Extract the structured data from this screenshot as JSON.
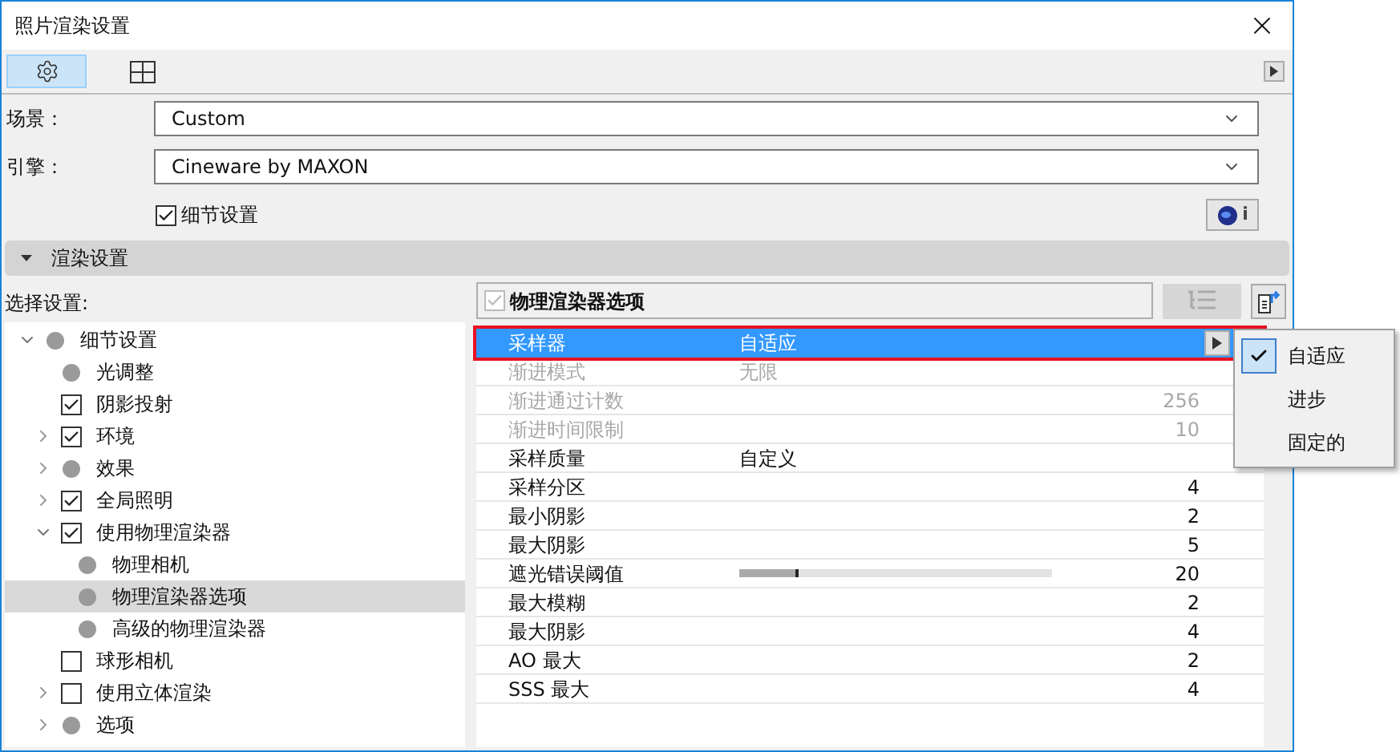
{
  "window": {
    "title": "照片渲染设置"
  },
  "toolbar": {
    "tabs": [
      {
        "selected": true
      },
      {
        "selected": false
      }
    ]
  },
  "fields": [
    {
      "label": "场景：",
      "value": "Custom"
    },
    {
      "label": "引擎：",
      "value": "Cineware by MAXON"
    }
  ],
  "detail_settings": {
    "label": "细节设置",
    "checked": true
  },
  "engine_info": {
    "label": "i"
  },
  "section": {
    "title": "渲染设置",
    "expanded": true
  },
  "select_label": "选择设置:",
  "panel_header": {
    "title": "物理渲染器选项",
    "checked": true
  },
  "tree": [
    {
      "label": "细节设置",
      "kind": "dot",
      "expanded": true,
      "selected": false,
      "children": [
        {
          "label": "光调整",
          "kind": "dot",
          "selected": false
        },
        {
          "label": "阴影投射",
          "kind": "checkbox",
          "checked": true,
          "selected": false
        },
        {
          "label": "环境",
          "kind": "checkbox",
          "checked": true,
          "expanded": false,
          "selected": false
        },
        {
          "label": "效果",
          "kind": "dot",
          "expanded": false,
          "selected": false
        },
        {
          "label": "全局照明",
          "kind": "checkbox",
          "checked": true,
          "expanded": false,
          "selected": false
        },
        {
          "label": "使用物理渲染器",
          "kind": "checkbox",
          "checked": true,
          "expanded": true,
          "selected": false,
          "children": [
            {
              "label": "物理相机",
              "kind": "dot",
              "selected": false
            },
            {
              "label": "物理渲染器选项",
              "kind": "dot",
              "selected": true
            },
            {
              "label": "高级的物理渲染器",
              "kind": "dot",
              "selected": false
            }
          ]
        },
        {
          "label": "球形相机",
          "kind": "checkbox",
          "checked": false,
          "selected": false
        },
        {
          "label": "使用立体渲染",
          "kind": "checkbox",
          "checked": false,
          "expanded": false,
          "selected": false
        },
        {
          "label": "选项",
          "kind": "dot",
          "expanded": false,
          "selected": false
        }
      ]
    }
  ],
  "properties": [
    {
      "name": "采样器",
      "kind": "text",
      "value": "自适应",
      "selected": true,
      "disabled": false
    },
    {
      "name": "渐进模式",
      "kind": "text",
      "value": "无限",
      "selected": false,
      "disabled": true
    },
    {
      "name": "渐进通过计数",
      "kind": "text",
      "reading": "256",
      "selected": false,
      "disabled": true
    },
    {
      "name": "渐进时间限制",
      "kind": "text",
      "reading": "10",
      "selected": false,
      "disabled": true
    },
    {
      "name": "采样质量",
      "kind": "text",
      "value": "自定义",
      "selected": false,
      "disabled": false
    },
    {
      "name": "采样分区",
      "kind": "text",
      "reading": "4",
      "selected": false,
      "disabled": false
    },
    {
      "name": "最小阴影",
      "kind": "text",
      "reading": "2",
      "selected": false,
      "disabled": false
    },
    {
      "name": "最大阴影",
      "kind": "text",
      "reading": "5",
      "selected": false,
      "disabled": false
    },
    {
      "name": "遮光错误阈值",
      "kind": "slider",
      "level": 0.19,
      "reading": "20",
      "selected": false,
      "disabled": false
    },
    {
      "name": "最大模糊",
      "kind": "text",
      "reading": "2",
      "selected": false,
      "disabled": false
    },
    {
      "name": "最大阴影",
      "kind": "text",
      "reading": "4",
      "selected": false,
      "disabled": false
    },
    {
      "name": "AO 最大",
      "kind": "text",
      "reading": "2",
      "selected": false,
      "disabled": false
    },
    {
      "name": "SSS 最大",
      "kind": "text",
      "reading": "4",
      "selected": false,
      "disabled": false
    }
  ],
  "popup_menu": [
    {
      "label": "自适应",
      "selected": true
    },
    {
      "label": "进步",
      "selected": false
    },
    {
      "label": "固定的",
      "selected": false
    }
  ]
}
